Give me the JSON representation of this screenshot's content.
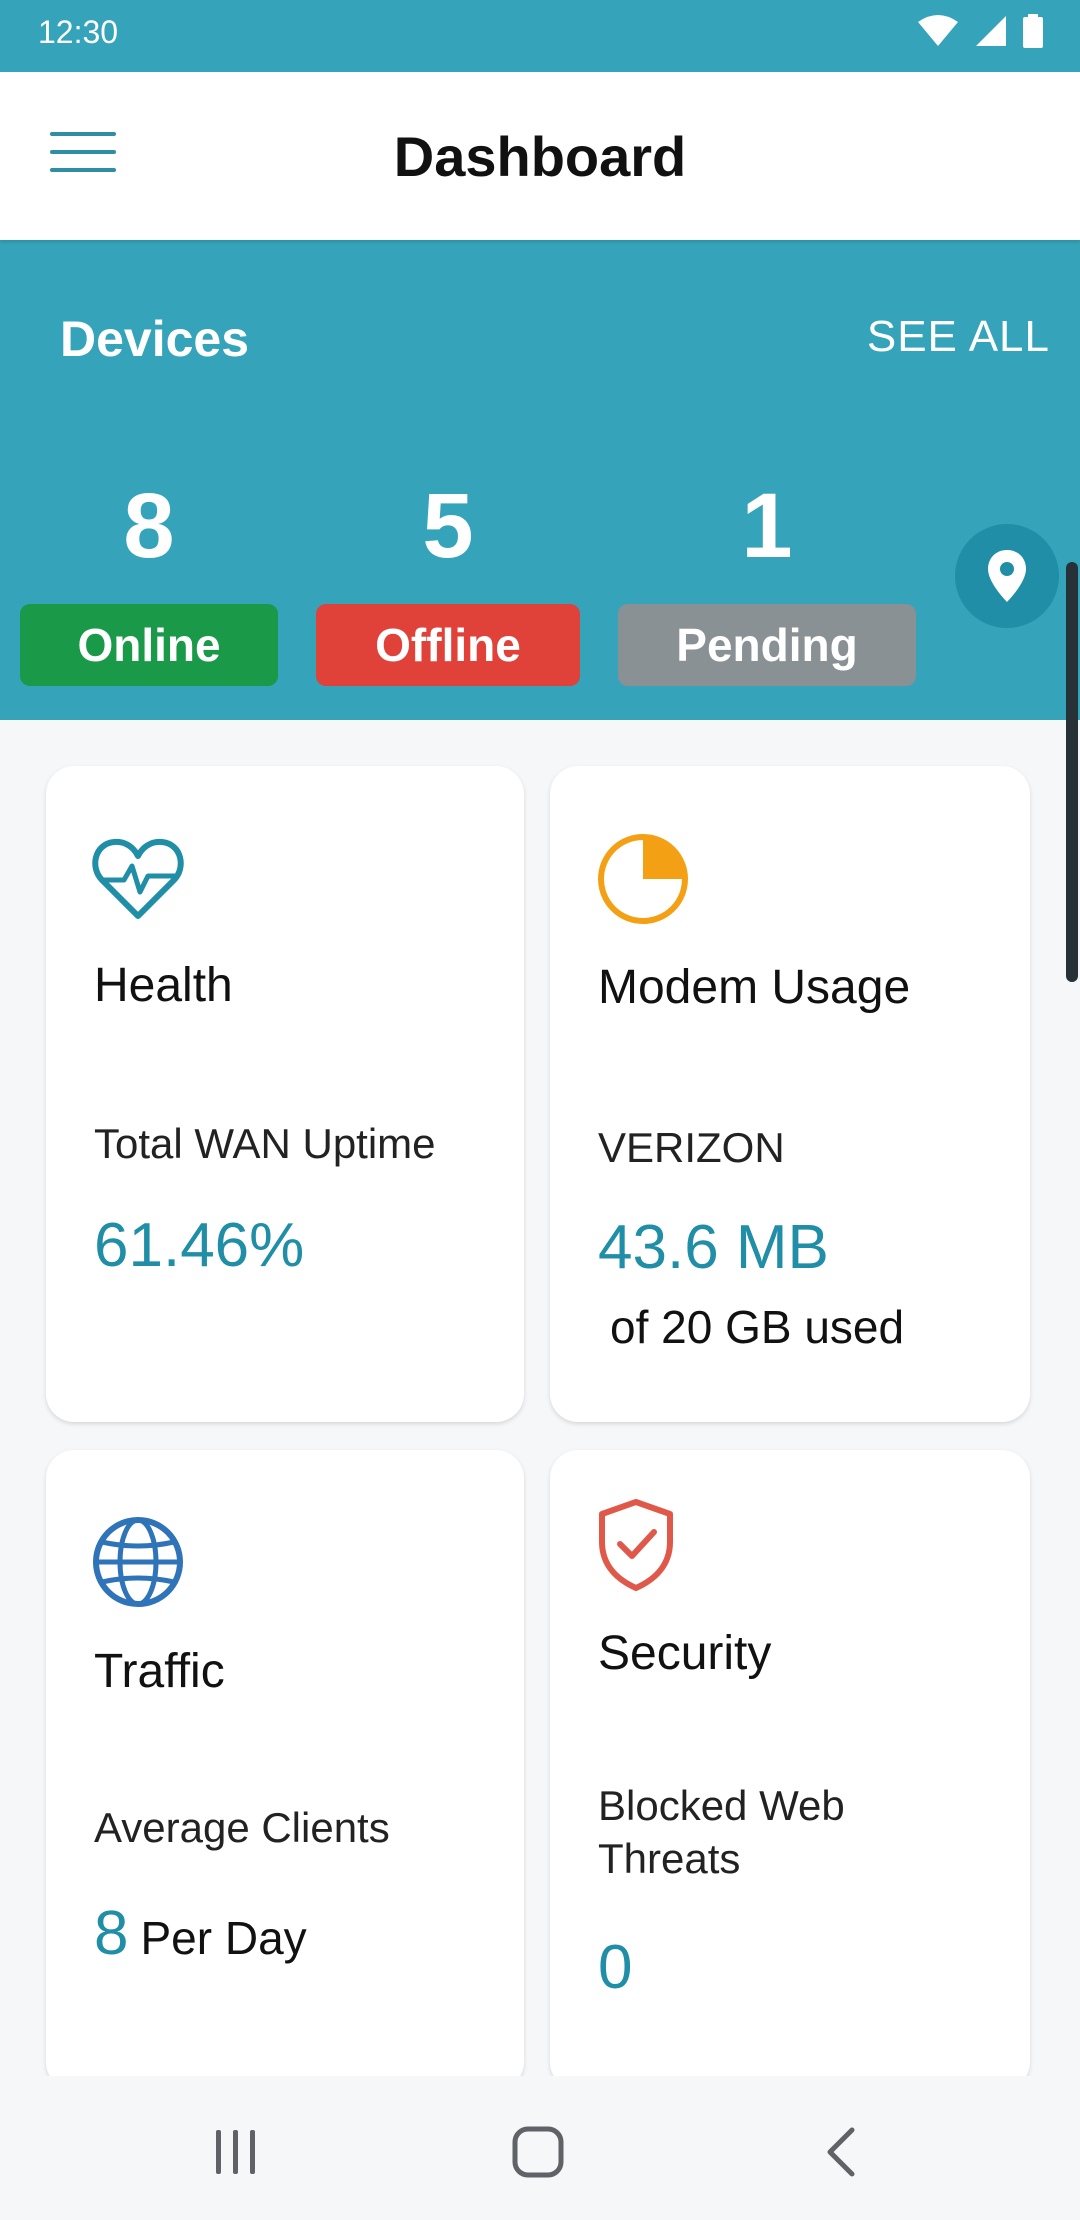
{
  "status_bar": {
    "time": "12:30",
    "icons": [
      "wifi-icon",
      "cell-signal-icon",
      "battery-icon"
    ]
  },
  "app_bar": {
    "title": "Dashboard",
    "menu_icon": "hamburger-menu-icon"
  },
  "devices": {
    "title": "Devices",
    "see_all": "SEE ALL",
    "online": {
      "count": "8",
      "label": "Online",
      "color": "#1a9a49"
    },
    "offline": {
      "count": "5",
      "label": "Offline",
      "color": "#e0423a"
    },
    "pending": {
      "count": "1",
      "label": "Pending",
      "color": "#8a9195"
    },
    "map_button_icon": "map-pin-icon"
  },
  "cards": {
    "health": {
      "icon": "heartbeat-icon",
      "title": "Health",
      "metric_label": "Total WAN Uptime",
      "metric_value": "61.46%"
    },
    "modem": {
      "icon": "pie-chart-icon",
      "title": "Modem Usage",
      "metric_label": "VERIZON",
      "metric_value": "43.6 MB",
      "metric_sub": "of 20 GB used"
    },
    "traffic": {
      "icon": "globe-icon",
      "title": "Traffic",
      "metric_label": "Average Clients",
      "metric_value": "8",
      "metric_unit": "Per Day"
    },
    "security": {
      "icon": "shield-check-icon",
      "title": "Security",
      "metric_label": "Blocked Web Threats",
      "metric_value": "0"
    }
  },
  "colors": {
    "brand": "#35a3b9",
    "accent": "#1f8ea6",
    "health_icon": "#1f8ea6",
    "modem_icon": "#f4a015",
    "traffic_icon": "#2f73b8",
    "security_icon": "#e0584a"
  },
  "nav_bar": {
    "buttons": [
      "recent-apps-icon",
      "home-icon",
      "back-icon"
    ]
  }
}
